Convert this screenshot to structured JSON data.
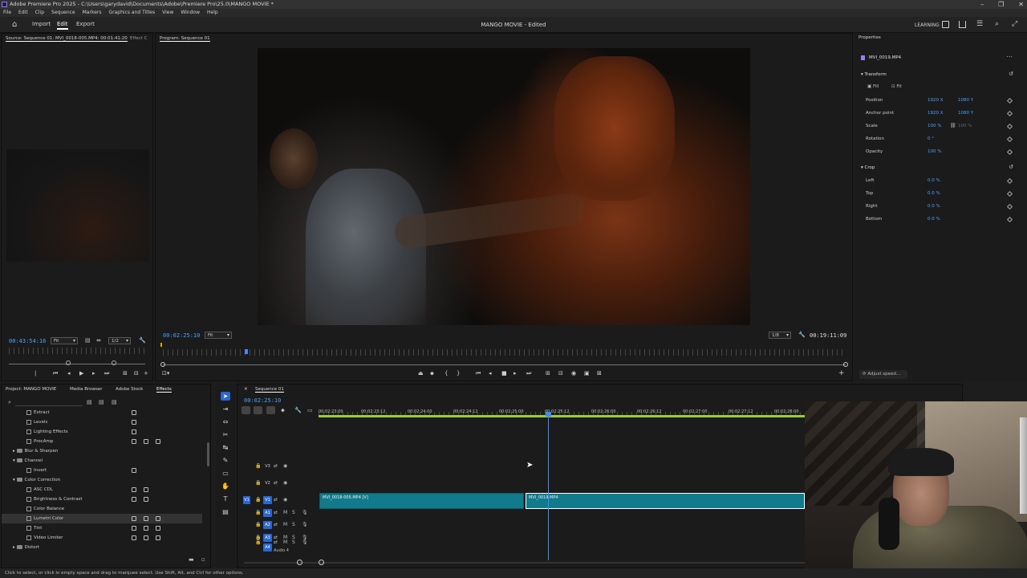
{
  "window": {
    "title": "Adobe Premiere Pro 2025 - C:\\Users\\garydavid\\Documents\\Adobe\\Premiere Pro\\25.0\\MANGO MOVIE *",
    "controls": [
      "–",
      "❐",
      "✕"
    ]
  },
  "menu": [
    "File",
    "Edit",
    "Clip",
    "Sequence",
    "Markers",
    "Graphics and Titles",
    "View",
    "Window",
    "Help"
  ],
  "header": {
    "nav": [
      "Import",
      "Edit",
      "Export"
    ],
    "active_nav": "Edit",
    "project_title": "MANGO MOVIE - Edited",
    "learning": "LEARNING"
  },
  "source": {
    "tab": "Source: Sequence 01: MVI_0018-005.MP4: 00:01:41:20",
    "tab2": "Effect C",
    "timecode": "00:43:54:16",
    "fit": "Fit",
    "resolution": "1/2"
  },
  "program": {
    "tab": "Program: Sequence 01",
    "timecode": "00:02:25:10",
    "fit": "Fit",
    "resolution": "1/8",
    "duration": "00:19:11:09"
  },
  "properties": {
    "tab": "Properties",
    "clip": "MVI_0019.MP4",
    "transform_title": "Transform",
    "fill": "Fill",
    "fit": "Fit",
    "rows": [
      {
        "label": "Position",
        "v1": "1920 X",
        "v2": "1080 Y"
      },
      {
        "label": "Anchor point",
        "v1": "1920 X",
        "v2": "1080 Y"
      },
      {
        "label": "Scale",
        "v1": "100 %",
        "v2": "100 %"
      },
      {
        "label": "Rotation",
        "v1": "0 °",
        "v2": ""
      },
      {
        "label": "Opacity",
        "v1": "100 %",
        "v2": ""
      }
    ],
    "crop_title": "Crop",
    "crop_rows": [
      {
        "label": "Left",
        "v1": "0.0 %"
      },
      {
        "label": "Top",
        "v1": "0.0 %"
      },
      {
        "label": "Right",
        "v1": "0.0 %"
      },
      {
        "label": "Bottom",
        "v1": "0.0 %"
      }
    ],
    "adjust_speed": "Adjust speed..."
  },
  "effects_panel": {
    "tabs": [
      "Project: MANGO MOVIE",
      "Media Browser",
      "Adobe Stock",
      "Effects"
    ],
    "active_tab": "Effects",
    "items": [
      {
        "label": "Extract",
        "indent": 3,
        "type": "fx"
      },
      {
        "label": "Levels",
        "indent": 3,
        "type": "fx"
      },
      {
        "label": "Lighting Effects",
        "indent": 3,
        "type": "fx"
      },
      {
        "label": "ProcAmp",
        "indent": 3,
        "type": "fx"
      },
      {
        "label": "Blur & Sharpen",
        "indent": 2,
        "type": "folder"
      },
      {
        "label": "Channel",
        "indent": 2,
        "type": "folder"
      },
      {
        "label": "Invert",
        "indent": 3,
        "type": "fx"
      },
      {
        "label": "Color Correction",
        "indent": 2,
        "type": "folder"
      },
      {
        "label": "ASC CDL",
        "indent": 3,
        "type": "fx"
      },
      {
        "label": "Brightness & Contrast",
        "indent": 3,
        "type": "fx"
      },
      {
        "label": "Color Balance",
        "indent": 3,
        "type": "fx"
      },
      {
        "label": "Lumetri Color",
        "indent": 3,
        "type": "fx",
        "selected": true
      },
      {
        "label": "Tint",
        "indent": 3,
        "type": "fx"
      },
      {
        "label": "Video Limiter",
        "indent": 3,
        "type": "fx"
      },
      {
        "label": "Distort",
        "indent": 2,
        "type": "folder"
      }
    ]
  },
  "timeline": {
    "tab": "Sequence 01",
    "timecode": "00:02:25:10",
    "ticks": [
      "00:02:23:00",
      "00:02:23:12",
      "00:02:24:00",
      "00:02:24:12",
      "00:02:25:00",
      "00:02:25:12",
      "00:02:26:00",
      "00:02:26:12",
      "00:02:27:00",
      "00:02:27:12",
      "00:02:28:00"
    ],
    "video_tracks": [
      "V3",
      "V2",
      "V1"
    ],
    "audio_tracks": [
      "A1",
      "A2",
      "A3",
      "A4"
    ],
    "audio4_label": "Audio 4",
    "clips": [
      {
        "label": "MVI_0018-005.MP4 [V]"
      },
      {
        "label": "MVI_0019.MP4"
      }
    ]
  },
  "status_text": "Click to select, or click in empty space and drag to marquee select. Use Shift, Alt, and Ctrl for other options.",
  "colors": {
    "accent": "#2b67d1",
    "timecode": "#4aa3ff",
    "clip": "#117a8b",
    "playhead": "#3f8cff"
  }
}
